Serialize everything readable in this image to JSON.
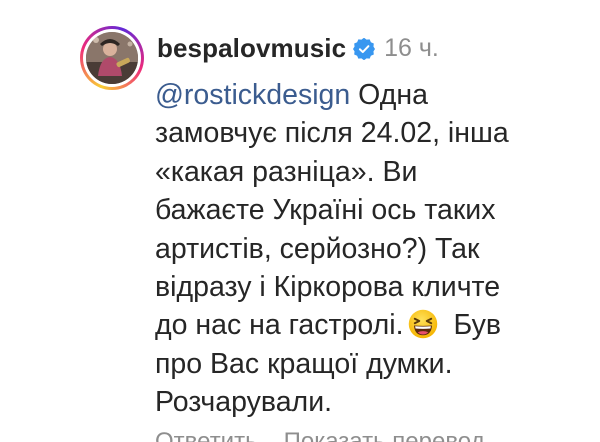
{
  "comment": {
    "username": "bespalovmusic",
    "verified": true,
    "timestamp": "16 ч.",
    "mention": "@rostickdesign",
    "lines": [
      " Одна",
      "замовчує після 24.02, інша",
      "«какая разніца». Ви",
      "бажаєте Україні ось таких",
      "артистів, серйозно?) Так",
      "відразу і Кіркорова кличте",
      "до нас на гастролі.",
      "Був",
      "про Вас кращої думки.",
      "Розчарували."
    ],
    "emoji": "laughing-face-emoji"
  },
  "actions": {
    "reply": "Ответить",
    "translate": "Показать перевод"
  },
  "colors": {
    "text": "#262626",
    "muted": "#8e8e8e",
    "mention": "#3b5c8f",
    "verified": "#3897f0"
  }
}
